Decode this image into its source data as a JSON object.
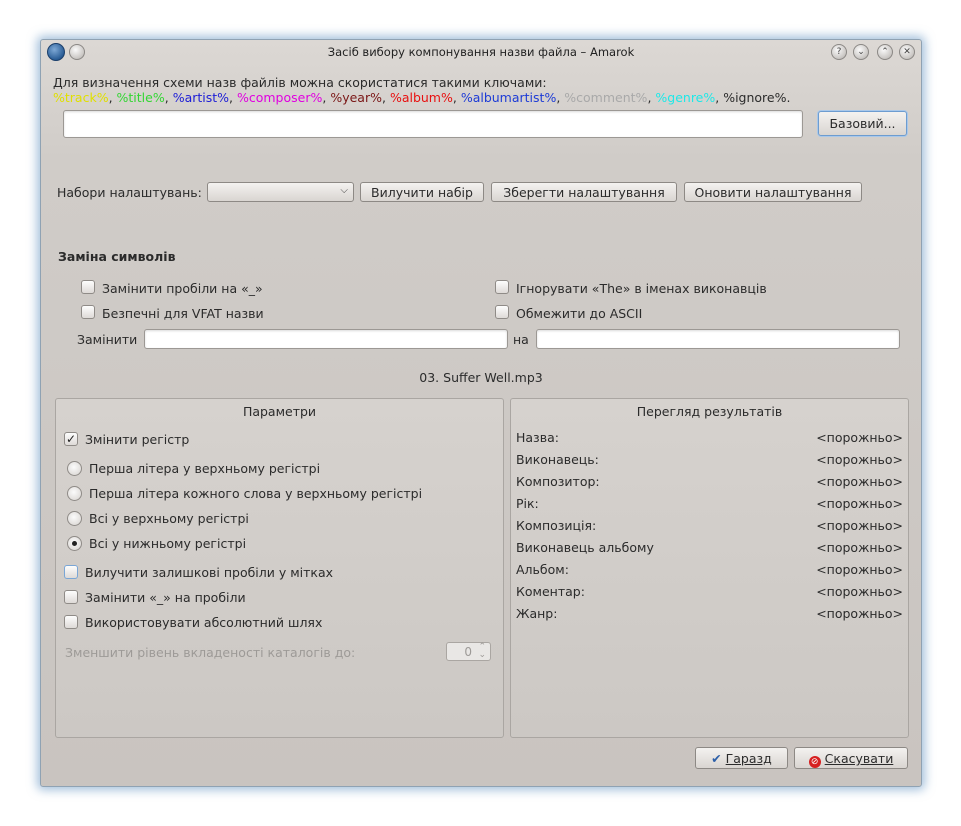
{
  "window": {
    "title": "Засіб вибору компонування назви файла – Amarok"
  },
  "titlebar_buttons": [
    "help-icon",
    "minimize-icon",
    "maximize-icon",
    "close-icon"
  ],
  "intro": {
    "line1": "Для визначення схеми назв файлів можна скористатися такими ключами:",
    "keys": [
      {
        "text": "%track%",
        "color": "#e0e000"
      },
      {
        "text": "%title%",
        "color": "#33d633"
      },
      {
        "text": "%artist%",
        "color": "#1d1dd6"
      },
      {
        "text": "%composer%",
        "color": "#e000e0"
      },
      {
        "text": "%year%",
        "color": "#7a1616"
      },
      {
        "text": "%album%",
        "color": "#e81010"
      },
      {
        "text": "%albumartist%",
        "color": "#1d3bd6"
      },
      {
        "text": "%comment%",
        "color": "#a9a9a9"
      },
      {
        "text": "%genre%",
        "color": "#1ee8e8"
      },
      {
        "text": "%ignore%",
        "color": "#2b2b2b"
      }
    ],
    "sep": ", ",
    "end": "."
  },
  "scheme": {
    "value": "",
    "basic_button": "Базовий..."
  },
  "presets": {
    "label": "Набори налаштувань:",
    "selected": "",
    "remove": "Вилучити набір",
    "save": "Зберегти налаштування",
    "update": "Оновити налаштування"
  },
  "chars": {
    "heading": "Заміна символів",
    "replace_spaces": "Замінити пробіли на «_»",
    "ignore_the": "Ігнорувати «The» в іменах виконавців",
    "vfat": "Безпечні для VFAT назви",
    "ascii": "Обмежити до ASCII",
    "replace_label": "Замінити",
    "replace_value": "",
    "with_label": "на",
    "with_value": ""
  },
  "preview_filename": "03.  Suffer Well.mp3",
  "params": {
    "title": "Параметри",
    "change_case": "Змінити регістр",
    "change_case_checked": true,
    "case_options": [
      {
        "label": "Перша літера у верхньому регістрі",
        "checked": false
      },
      {
        "label": "Перша літера кожного слова у верхньому регістрі",
        "checked": false
      },
      {
        "label": "Всі у верхньому регістрі",
        "checked": false
      },
      {
        "label": "Всі у нижньому регістрі",
        "checked": true
      }
    ],
    "strip_spaces": "Вилучити залишкові пробіли у мітках",
    "underscores": "Замінити «_» на пробіли",
    "absolute_path": "Використовувати абсолютний шлях",
    "cut_dirs_label": "Зменшити рівень вкладеності каталогів до:",
    "cut_dirs_value": "0"
  },
  "results": {
    "title": "Перегляд результатів",
    "rows": [
      {
        "label": "Назва:",
        "value": "<порожньо>"
      },
      {
        "label": "Виконавець:",
        "value": "<порожньо>"
      },
      {
        "label": "Композитор:",
        "value": "<порожньо>"
      },
      {
        "label": "Рік:",
        "value": "<порожньо>"
      },
      {
        "label": "Композиція:",
        "value": "<порожньо>"
      },
      {
        "label": "Виконавець альбому",
        "value": "<порожньо>"
      },
      {
        "label": "Альбом:",
        "value": "<порожньо>"
      },
      {
        "label": "Коментар:",
        "value": "<порожньо>"
      },
      {
        "label": "Жанр:",
        "value": "<порожньо>"
      }
    ]
  },
  "footer": {
    "ok": "Гаразд",
    "cancel": "Скасувати"
  }
}
